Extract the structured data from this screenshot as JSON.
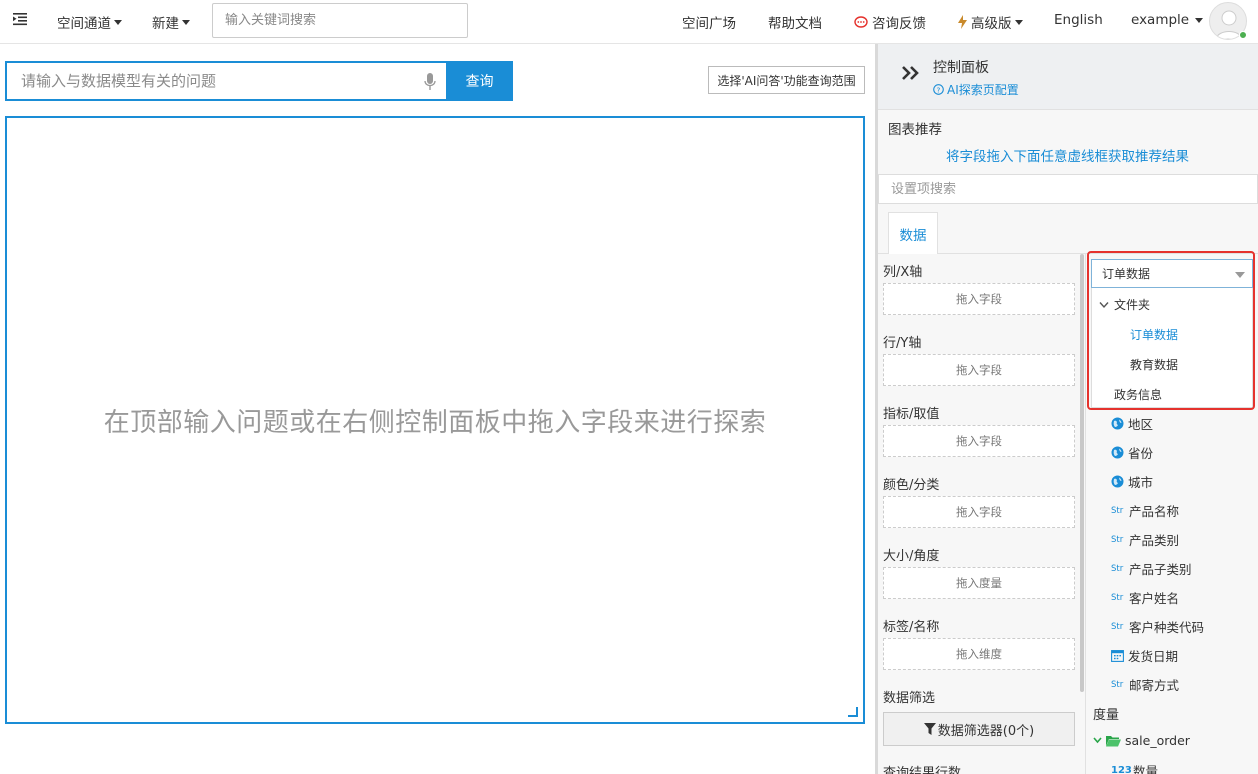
{
  "topbar": {
    "space_channel": "空间通道",
    "create": "新建",
    "search_placeholder": "输入关键词搜索",
    "space_plaza": "空间广场",
    "help_docs": "帮助文档",
    "feedback": "咨询反馈",
    "advanced": "高级版",
    "language": "English",
    "user": "example"
  },
  "query": {
    "placeholder": "请输入与数据模型有关的问题",
    "submit_label": "查询",
    "scope_label": "选择'AI问答'功能查询范围"
  },
  "canvas": {
    "hint": "在顶部输入问题或在右侧控制面板中拖入字段来进行探索"
  },
  "panel": {
    "title": "控制面板",
    "ai_config_link": "AI探索页配置",
    "chart_rec_title": "图表推荐",
    "chart_rec_hint": "将字段拖入下面任意虚线框获取推荐结果",
    "settings_search_placeholder": "设置项搜索",
    "tab_data": "数据",
    "fields": [
      {
        "label": "列/X轴",
        "drop": "拖入字段"
      },
      {
        "label": "行/Y轴",
        "drop": "拖入字段"
      },
      {
        "label": "指标/取值",
        "drop": "拖入字段"
      },
      {
        "label": "颜色/分类",
        "drop": "拖入字段"
      },
      {
        "label": "大小/角度",
        "drop": "拖入度量"
      },
      {
        "label": "标签/名称",
        "drop": "拖入维度"
      }
    ],
    "data_filter_label": "数据筛选",
    "data_filter_button": "数据筛选器(0个)",
    "query_result_rows": "查询结果行数"
  },
  "dataset": {
    "selected": "订单数据",
    "folder": "文件夹",
    "options": [
      "订单数据",
      "教育数据"
    ],
    "other": "政务信息"
  },
  "field_list": [
    {
      "icon": "globe",
      "name": "地区"
    },
    {
      "icon": "globe",
      "name": "省份"
    },
    {
      "icon": "globe",
      "name": "城市"
    },
    {
      "icon": "str",
      "name": "产品名称"
    },
    {
      "icon": "str",
      "name": "产品类别"
    },
    {
      "icon": "str",
      "name": "产品子类别"
    },
    {
      "icon": "str",
      "name": "客户姓名"
    },
    {
      "icon": "str",
      "name": "客户种类代码"
    },
    {
      "icon": "calendar",
      "name": "发货日期"
    },
    {
      "icon": "str",
      "name": "邮寄方式"
    }
  ],
  "measures": {
    "label": "度量",
    "folder": "sale_order",
    "first_item": "数量",
    "first_icon_text": "123"
  },
  "icons": {
    "str_text": "Str"
  },
  "colors": {
    "accent": "#1a8dd6",
    "highlight": "#e5322d",
    "online": "#4caf50"
  }
}
